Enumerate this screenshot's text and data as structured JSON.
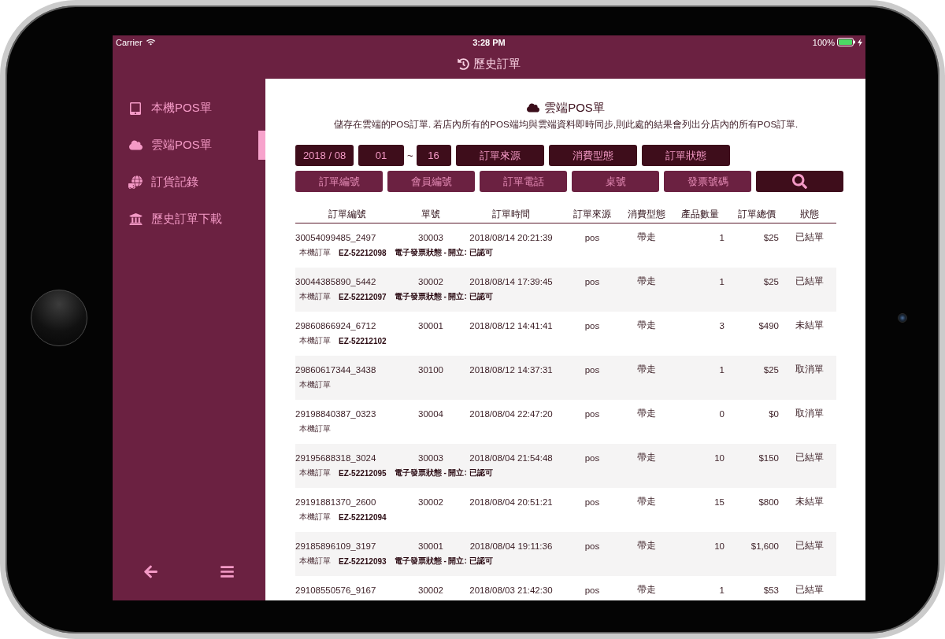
{
  "status_bar": {
    "carrier": "Carrier",
    "time": "3:28 PM",
    "battery": "100%"
  },
  "nav_bar": {
    "title": "歷史訂單"
  },
  "sidebar": {
    "items": [
      {
        "label": "本機POS單",
        "selected": false
      },
      {
        "label": "雲端POS單",
        "selected": true
      },
      {
        "label": "訂貨記錄",
        "selected": false
      },
      {
        "label": "歷史訂單下載",
        "selected": false
      }
    ]
  },
  "content": {
    "title": "雲端POS單",
    "description": "儲存在雲端的POS訂單. 若店內所有的POS端均與雲端資料即時同步,則此處的結果會列出分店內的所有POS訂單.",
    "date_filter": {
      "month": "2018 / 08",
      "day_from": "01",
      "separator": "~",
      "day_to": "16"
    },
    "filters": [
      "訂單來源",
      "消費型態",
      "訂單狀態"
    ],
    "search_fields": [
      {
        "placeholder": "訂單編號"
      },
      {
        "placeholder": "會員編號"
      },
      {
        "placeholder": "訂單電話"
      },
      {
        "placeholder": "桌號"
      },
      {
        "placeholder": "發票號碼"
      }
    ],
    "table": {
      "columns": [
        "訂單編號",
        "單號",
        "訂單時間",
        "訂單來源",
        "消費型態",
        "產品數量",
        "訂單總價",
        "狀態"
      ],
      "rows": [
        {
          "order_id": "30054099485_2497",
          "number": "30003",
          "time": "2018/08/14 20:21:39",
          "source": "pos",
          "type": "帶走",
          "quantity": "1",
          "total": "$25",
          "status": "已結單",
          "tag": "本機訂單",
          "invoice_no": "EZ-52212098",
          "invoice_status": "電子發票狀態 - 開立: 已認可"
        },
        {
          "order_id": "30044385890_5442",
          "number": "30002",
          "time": "2018/08/14 17:39:45",
          "source": "pos",
          "type": "帶走",
          "quantity": "1",
          "total": "$25",
          "status": "已結單",
          "tag": "本機訂單",
          "invoice_no": "EZ-52212097",
          "invoice_status": "電子發票狀態 - 開立: 已認可"
        },
        {
          "order_id": "29860866924_6712",
          "number": "30001",
          "time": "2018/08/12 14:41:41",
          "source": "pos",
          "type": "帶走",
          "quantity": "3",
          "total": "$490",
          "status": "未結單",
          "tag": "本機訂單",
          "invoice_no": "EZ-52212102"
        },
        {
          "order_id": "29860617344_3438",
          "number": "30100",
          "time": "2018/08/12 14:37:31",
          "source": "pos",
          "type": "帶走",
          "quantity": "1",
          "total": "$25",
          "status": "取消單",
          "tag": "本機訂單"
        },
        {
          "order_id": "29198840387_0323",
          "number": "30004",
          "time": "2018/08/04 22:47:20",
          "source": "pos",
          "type": "帶走",
          "quantity": "0",
          "total": "$0",
          "status": "取消單",
          "tag": "本機訂單"
        },
        {
          "order_id": "29195688318_3024",
          "number": "30003",
          "time": "2018/08/04 21:54:48",
          "source": "pos",
          "type": "帶走",
          "quantity": "10",
          "total": "$150",
          "status": "已結單",
          "tag": "本機訂單",
          "invoice_no": "EZ-52212095",
          "invoice_status": "電子發票狀態 - 開立: 已認可"
        },
        {
          "order_id": "29191881370_2600",
          "number": "30002",
          "time": "2018/08/04 20:51:21",
          "source": "pos",
          "type": "帶走",
          "quantity": "15",
          "total": "$800",
          "status": "未結單",
          "tag": "本機訂單",
          "invoice_no": "EZ-52212094"
        },
        {
          "order_id": "29185896109_3197",
          "number": "30001",
          "time": "2018/08/04 19:11:36",
          "source": "pos",
          "type": "帶走",
          "quantity": "10",
          "total": "$1,600",
          "status": "已結單",
          "tag": "本機訂單",
          "invoice_no": "EZ-52212093",
          "invoice_status": "電子發票狀態 - 開立: 已認可"
        },
        {
          "order_id": "29108550576_9167",
          "number": "30002",
          "time": "2018/08/03 21:42:30",
          "source": "pos",
          "type": "帶走",
          "quantity": "1",
          "total": "$53",
          "status": "已結單"
        }
      ]
    }
  }
}
